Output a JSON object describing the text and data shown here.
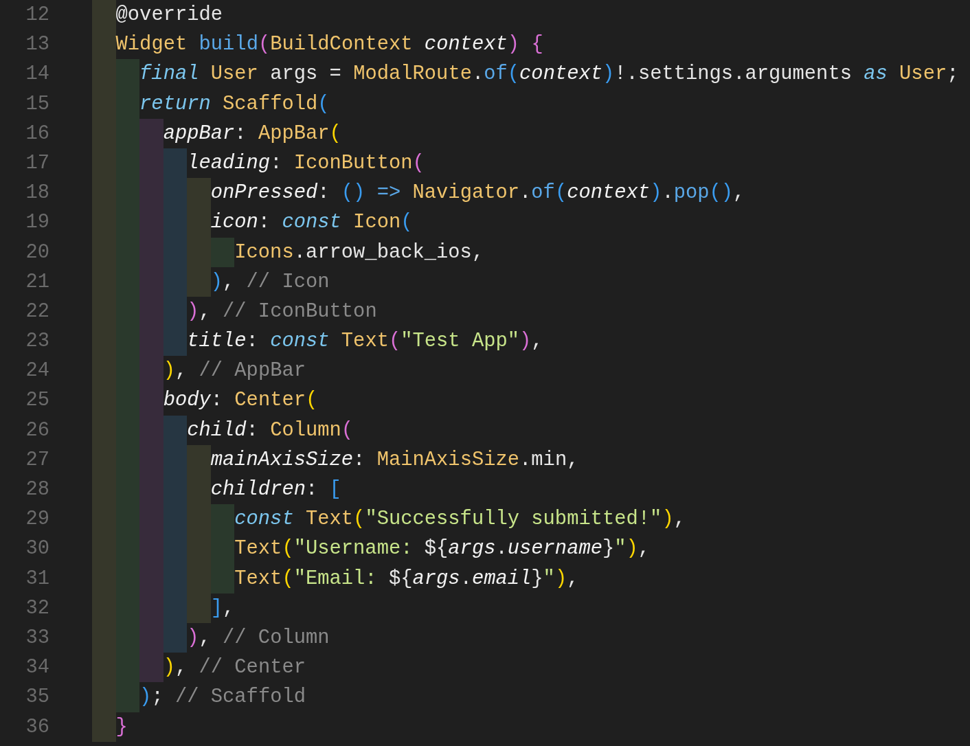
{
  "editor": {
    "lines": [
      {
        "number": "12",
        "tokens": [
          {
            "kind": "plain",
            "text": "@override"
          }
        ]
      },
      {
        "number": "13",
        "tokens": [
          {
            "kind": "type",
            "text": "Widget"
          },
          {
            "kind": "function",
            "text": " build"
          },
          {
            "kind": "orchid",
            "text": "("
          },
          {
            "kind": "type",
            "text": "BuildContext"
          },
          {
            "kind": "param",
            "text": " context"
          },
          {
            "kind": "orchid",
            "text": ")"
          },
          {
            "kind": "orchid",
            "text": " {"
          }
        ],
        "children": [
          {
            "number": "14",
            "tokens": [
              {
                "kind": "keyword",
                "text": "final"
              },
              {
                "kind": "type",
                "text": " User"
              },
              {
                "kind": "plain",
                "text": " args = "
              },
              {
                "kind": "type",
                "text": "ModalRoute"
              },
              {
                "kind": "plain",
                "text": "."
              },
              {
                "kind": "function",
                "text": "of"
              },
              {
                "kind": "azure",
                "text": "("
              },
              {
                "kind": "param",
                "text": "context"
              },
              {
                "kind": "azure",
                "text": ")"
              },
              {
                "kind": "plain",
                "text": "!.settings.arguments "
              },
              {
                "kind": "keyword",
                "text": "as"
              },
              {
                "kind": "type",
                "text": " User"
              },
              {
                "kind": "plain",
                "text": ";"
              }
            ]
          },
          {
            "number": "15",
            "tokens": [
              {
                "kind": "keyword",
                "text": "return"
              },
              {
                "kind": "type",
                "text": " Scaffold"
              },
              {
                "kind": "azure",
                "text": "("
              }
            ],
            "children": [
              {
                "number": "16",
                "tokens": [
                  {
                    "kind": "param",
                    "text": "appBar"
                  },
                  {
                    "kind": "plain",
                    "text": ": "
                  },
                  {
                    "kind": "type",
                    "text": "AppBar"
                  },
                  {
                    "kind": "gold",
                    "text": "("
                  }
                ],
                "children": [
                  {
                    "number": "17",
                    "tokens": [
                      {
                        "kind": "param",
                        "text": "leading"
                      },
                      {
                        "kind": "plain",
                        "text": ": "
                      },
                      {
                        "kind": "type",
                        "text": "IconButton"
                      },
                      {
                        "kind": "orchid",
                        "text": "("
                      }
                    ],
                    "children": [
                      {
                        "number": "18",
                        "tokens": [
                          {
                            "kind": "param",
                            "text": "onPressed"
                          },
                          {
                            "kind": "plain",
                            "text": ": "
                          },
                          {
                            "kind": "azure",
                            "text": "()"
                          },
                          {
                            "kind": "operator",
                            "text": " =>"
                          },
                          {
                            "kind": "type",
                            "text": " Navigator"
                          },
                          {
                            "kind": "plain",
                            "text": "."
                          },
                          {
                            "kind": "function",
                            "text": "of"
                          },
                          {
                            "kind": "azure",
                            "text": "("
                          },
                          {
                            "kind": "param",
                            "text": "context"
                          },
                          {
                            "kind": "azure",
                            "text": ")"
                          },
                          {
                            "kind": "plain",
                            "text": "."
                          },
                          {
                            "kind": "function",
                            "text": "pop"
                          },
                          {
                            "kind": "azure",
                            "text": "()"
                          },
                          {
                            "kind": "plain",
                            "text": ","
                          }
                        ]
                      },
                      {
                        "number": "19",
                        "tokens": [
                          {
                            "kind": "param",
                            "text": "icon"
                          },
                          {
                            "kind": "plain",
                            "text": ": "
                          },
                          {
                            "kind": "keyword",
                            "text": "const"
                          },
                          {
                            "kind": "type",
                            "text": " Icon"
                          },
                          {
                            "kind": "azure",
                            "text": "("
                          }
                        ],
                        "children": [
                          {
                            "number": "20",
                            "tokens": [
                              {
                                "kind": "type",
                                "text": "Icons"
                              },
                              {
                                "kind": "plain",
                                "text": ".arrow_back_ios,"
                              }
                            ]
                          }
                        ]
                      },
                      {
                        "number": "21",
                        "tokens": [
                          {
                            "kind": "azure",
                            "text": ")"
                          },
                          {
                            "kind": "plain",
                            "text": ", "
                          },
                          {
                            "kind": "comment",
                            "text": "// Icon"
                          }
                        ]
                      }
                    ]
                  },
                  {
                    "number": "22",
                    "tokens": [
                      {
                        "kind": "orchid",
                        "text": ")"
                      },
                      {
                        "kind": "plain",
                        "text": ", "
                      },
                      {
                        "kind": "comment",
                        "text": "// IconButton"
                      }
                    ]
                  },
                  {
                    "number": "23",
                    "tokens": [
                      {
                        "kind": "param",
                        "text": "title"
                      },
                      {
                        "kind": "plain",
                        "text": ": "
                      },
                      {
                        "kind": "keyword",
                        "text": "const"
                      },
                      {
                        "kind": "type",
                        "text": " Text"
                      },
                      {
                        "kind": "orchid",
                        "text": "("
                      },
                      {
                        "kind": "string",
                        "text": "\"Test App\""
                      },
                      {
                        "kind": "orchid",
                        "text": ")"
                      },
                      {
                        "kind": "plain",
                        "text": ","
                      }
                    ]
                  }
                ]
              },
              {
                "number": "24",
                "tokens": [
                  {
                    "kind": "gold",
                    "text": ")"
                  },
                  {
                    "kind": "plain",
                    "text": ", "
                  },
                  {
                    "kind": "comment",
                    "text": "// AppBar"
                  }
                ]
              },
              {
                "number": "25",
                "tokens": [
                  {
                    "kind": "param",
                    "text": "body"
                  },
                  {
                    "kind": "plain",
                    "text": ": "
                  },
                  {
                    "kind": "type",
                    "text": "Center"
                  },
                  {
                    "kind": "gold",
                    "text": "("
                  }
                ],
                "children": [
                  {
                    "number": "26",
                    "tokens": [
                      {
                        "kind": "param",
                        "text": "child"
                      },
                      {
                        "kind": "plain",
                        "text": ": "
                      },
                      {
                        "kind": "type",
                        "text": "Column"
                      },
                      {
                        "kind": "orchid",
                        "text": "("
                      }
                    ],
                    "children": [
                      {
                        "number": "27",
                        "tokens": [
                          {
                            "kind": "param",
                            "text": "mainAxisSize"
                          },
                          {
                            "kind": "plain",
                            "text": ": "
                          },
                          {
                            "kind": "type",
                            "text": "MainAxisSize"
                          },
                          {
                            "kind": "plain",
                            "text": ".min,"
                          }
                        ]
                      },
                      {
                        "number": "28",
                        "tokens": [
                          {
                            "kind": "param",
                            "text": "children"
                          },
                          {
                            "kind": "plain",
                            "text": ": "
                          },
                          {
                            "kind": "azure",
                            "text": "["
                          }
                        ],
                        "children": [
                          {
                            "number": "29",
                            "tokens": [
                              {
                                "kind": "keyword",
                                "text": "const"
                              },
                              {
                                "kind": "type",
                                "text": " Text"
                              },
                              {
                                "kind": "gold",
                                "text": "("
                              },
                              {
                                "kind": "string",
                                "text": "\"Successfully submitted!\""
                              },
                              {
                                "kind": "gold",
                                "text": ")"
                              },
                              {
                                "kind": "plain",
                                "text": ","
                              }
                            ]
                          },
                          {
                            "number": "30",
                            "tokens": [
                              {
                                "kind": "type",
                                "text": "Text"
                              },
                              {
                                "kind": "gold",
                                "text": "("
                              },
                              {
                                "kind": "string",
                                "text": "\"Username: "
                              },
                              {
                                "kind": "plain",
                                "text": "${"
                              },
                              {
                                "kind": "param",
                                "text": "args"
                              },
                              {
                                "kind": "plain",
                                "text": "."
                              },
                              {
                                "kind": "param",
                                "text": "username"
                              },
                              {
                                "kind": "plain",
                                "text": "}"
                              },
                              {
                                "kind": "string",
                                "text": "\""
                              },
                              {
                                "kind": "gold",
                                "text": ")"
                              },
                              {
                                "kind": "plain",
                                "text": ","
                              }
                            ]
                          },
                          {
                            "number": "31",
                            "tokens": [
                              {
                                "kind": "type",
                                "text": "Text"
                              },
                              {
                                "kind": "gold",
                                "text": "("
                              },
                              {
                                "kind": "string",
                                "text": "\"Email: "
                              },
                              {
                                "kind": "plain",
                                "text": "${"
                              },
                              {
                                "kind": "param",
                                "text": "args"
                              },
                              {
                                "kind": "plain",
                                "text": "."
                              },
                              {
                                "kind": "param",
                                "text": "email"
                              },
                              {
                                "kind": "plain",
                                "text": "}"
                              },
                              {
                                "kind": "string",
                                "text": "\""
                              },
                              {
                                "kind": "gold",
                                "text": ")"
                              },
                              {
                                "kind": "plain",
                                "text": ","
                              }
                            ]
                          }
                        ]
                      },
                      {
                        "number": "32",
                        "tokens": [
                          {
                            "kind": "azure",
                            "text": "]"
                          },
                          {
                            "kind": "plain",
                            "text": ","
                          }
                        ]
                      }
                    ]
                  },
                  {
                    "number": "33",
                    "tokens": [
                      {
                        "kind": "orchid",
                        "text": ")"
                      },
                      {
                        "kind": "plain",
                        "text": ", "
                      },
                      {
                        "kind": "comment",
                        "text": "// Column"
                      }
                    ]
                  }
                ]
              },
              {
                "number": "34",
                "tokens": [
                  {
                    "kind": "gold",
                    "text": ")"
                  },
                  {
                    "kind": "plain",
                    "text": ", "
                  },
                  {
                    "kind": "comment",
                    "text": "// Center"
                  }
                ]
              }
            ]
          },
          {
            "number": "35",
            "tokens": [
              {
                "kind": "azure",
                "text": ")"
              },
              {
                "kind": "plain",
                "text": "; "
              },
              {
                "kind": "comment",
                "text": "// Scaffold"
              }
            ]
          }
        ]
      },
      {
        "number": "36",
        "tokens": [
          {
            "kind": "orchid",
            "text": "}"
          }
        ]
      }
    ]
  }
}
